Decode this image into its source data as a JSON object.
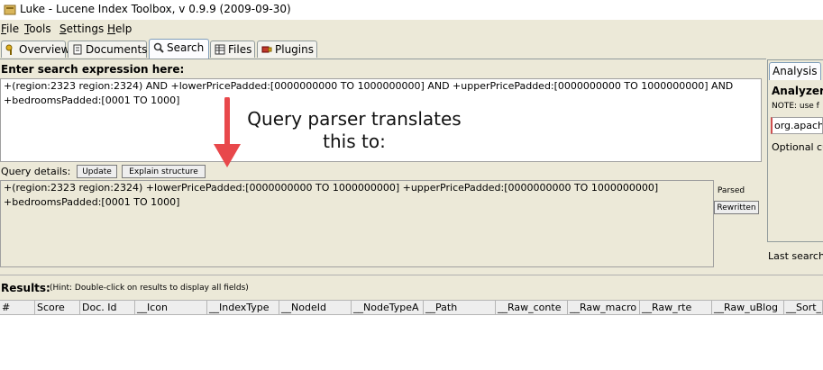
{
  "window": {
    "title": "Luke - Lucene Index Toolbox, v 0.9.9 (2009-09-30)"
  },
  "menu": [
    {
      "label": "File",
      "mnemonic": "F",
      "rest": "ile"
    },
    {
      "label": "Tools",
      "mnemonic": "T",
      "rest": "ools"
    },
    {
      "label": "Settings",
      "mnemonic": "S",
      "rest": "ettings"
    },
    {
      "label": "Help",
      "mnemonic": "H",
      "rest": "elp"
    }
  ],
  "tabs": [
    {
      "label": "Overview",
      "icon": "key-icon",
      "active": false
    },
    {
      "label": "Documents",
      "icon": "document-icon",
      "active": false
    },
    {
      "label": "Search",
      "icon": "magnifier-icon",
      "active": true
    },
    {
      "label": "Files",
      "icon": "grid-icon",
      "active": false
    },
    {
      "label": "Plugins",
      "icon": "plugin-icon",
      "active": false
    }
  ],
  "search": {
    "heading": "Enter search expression here:",
    "expression": "+(region:2323 region:2324) AND +lowerPricePadded:[0000000000 TO 1000000000] AND +upperPricePadded:[0000000000 TO 1000000000] AND\n+bedroomsPadded:[0001 TO 1000]"
  },
  "query_details": {
    "label": "Query details:",
    "update_button": "Update",
    "explain_button": "Explain structure",
    "parsed_text": "+(region:2323 region:2324) +lowerPricePadded:[0000000000 TO 1000000000] +upperPricePadded:[0000000000 TO 1000000000]\n+bedroomsPadded:[0001 TO 1000]",
    "parsed_button": "Parsed",
    "rewritten_button": "Rewritten"
  },
  "annotation": {
    "line1": "Query parser translates",
    "line2": "this to:",
    "arrow_color": "#e8484b"
  },
  "analysis": {
    "tab_label": "Analysis",
    "analyzer_label": "Analyzer to",
    "note": "NOTE: use f",
    "analyzer_value": "org.apach",
    "optional": "Optional cu",
    "last_search": "Last search"
  },
  "results": {
    "label": "Results:",
    "hint": "(Hint: Double-click on results to display all fields)",
    "columns": [
      "#",
      "Score",
      "Doc. Id",
      "__Icon",
      "__IndexType",
      "__NodeId",
      "__NodeTypeA",
      "__Path",
      "__Raw_conte",
      "__Raw_macro",
      "__Raw_rte",
      "__Raw_uBlog",
      "__Sort_"
    ]
  }
}
